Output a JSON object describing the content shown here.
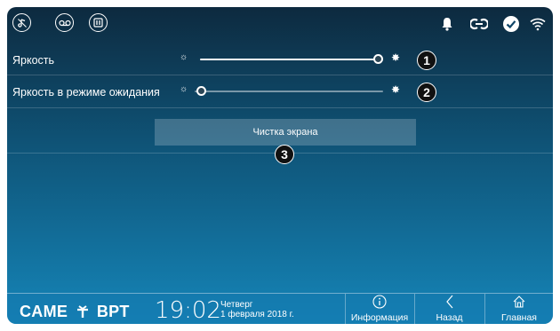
{
  "topbar": {
    "left_icons": [
      "music-mute-icon",
      "voicemail-icon",
      "door-open-icon"
    ],
    "right_icons": [
      "bell-icon",
      "link-icon",
      "check-circle-icon",
      "wifi-icon"
    ]
  },
  "settings": {
    "brightness": {
      "label": "Яркость",
      "level": 0.97
    },
    "standby_brightness": {
      "label": "Яркость в режиме ожидания",
      "level": 0.0
    },
    "clean_button_label": "Чистка экрана"
  },
  "callouts": [
    "1",
    "2",
    "3"
  ],
  "bottombar": {
    "brand": "CAME",
    "brand2": "BPT",
    "time": "19:02",
    "weekday": "Четверг",
    "date": "1 февраля 2018 г.",
    "info_label": "Информация",
    "back_label": "Назад",
    "home_label": "Главная"
  },
  "colors": {
    "accent": "#1585b8",
    "background_top": "#0d2a3f"
  }
}
